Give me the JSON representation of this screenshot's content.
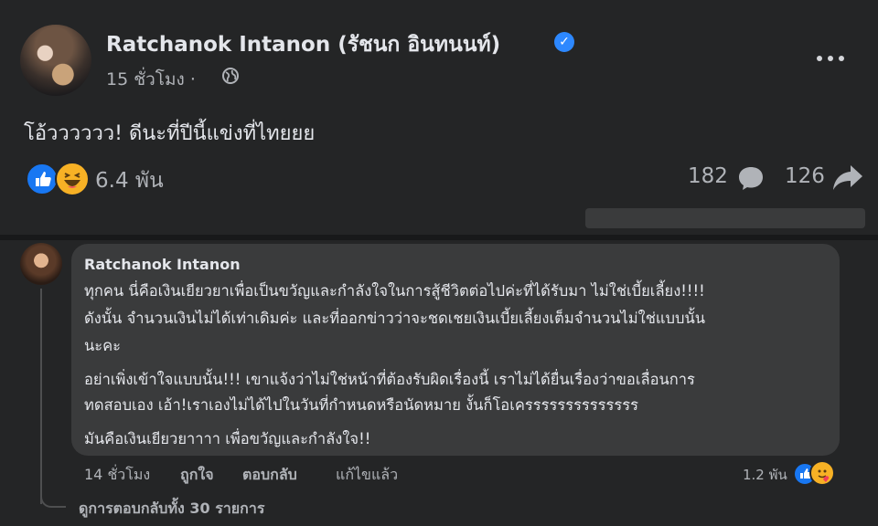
{
  "post": {
    "author": "Ratchanok Intanon (รัชนก อินทนนท์)",
    "time": "15 ชั่วโมง ·",
    "text": "โอ้วววววว! ดีนะที่ปีนี้แข่งที่ไทยยย",
    "reactions_count": "6.4 พัน",
    "comments_count": "182",
    "shares_count": "126"
  },
  "comment": {
    "author": "Ratchanok Intanon",
    "lines": [
      "ทุกคน นี่คือเงินเยียวยาเพื่อเป็นขวัญและกำลังใจในการสู้ชีวิตต่อไปค่ะที่ได้รับมา ไม่ใช่เบี้ยเลี้ยง!!!!",
      "ดังนั้น จำนวนเงินไม่ได้เท่าเดิมค่ะ และที่ออกข่าวว่าจะชดเชยเงินเบี้ยเลี้ยงเต็มจำนวนไม่ใช่แบบนั้น",
      "นะคะ",
      "อย่าเพิ่งเข้าใจแบบนั้น!!! เขาแจ้งว่าไม่ใช่หน้าที่ต้องรับผิดเรื่องนี้ เราไม่ได้ยื่นเรื่องว่าขอเลื่อนการ",
      "ทดสอบเอง เอ้า!เราเองไม่ได้ไปในวันที่กำหนดหรือนัดหมาย งั้นก็โอเครรรรรรรรรรรรรร",
      "มันคือเงินเยียวยาาาา เพื่อขวัญและกำลังใจ!!"
    ],
    "time": "14 ชั่วโมง",
    "like_label": "ถูกใจ",
    "reply_label": "ตอบกลับ",
    "edited_label": "แก้ไขแล้ว",
    "reactions_count": "1.2 พัน",
    "view_replies": "ดูการตอบกลับทั้ง 30 รายการ"
  },
  "icons": [
    "verified-icon",
    "globe-icon",
    "more-icon",
    "like-icon",
    "haha-icon",
    "comment-icon",
    "share-icon",
    "care-icon"
  ],
  "colors": {
    "background": "#242526",
    "bubble": "#3a3b3c",
    "accent": "#2d88ff",
    "text": "#e4e6eb",
    "muted": "#b0b3b8"
  }
}
